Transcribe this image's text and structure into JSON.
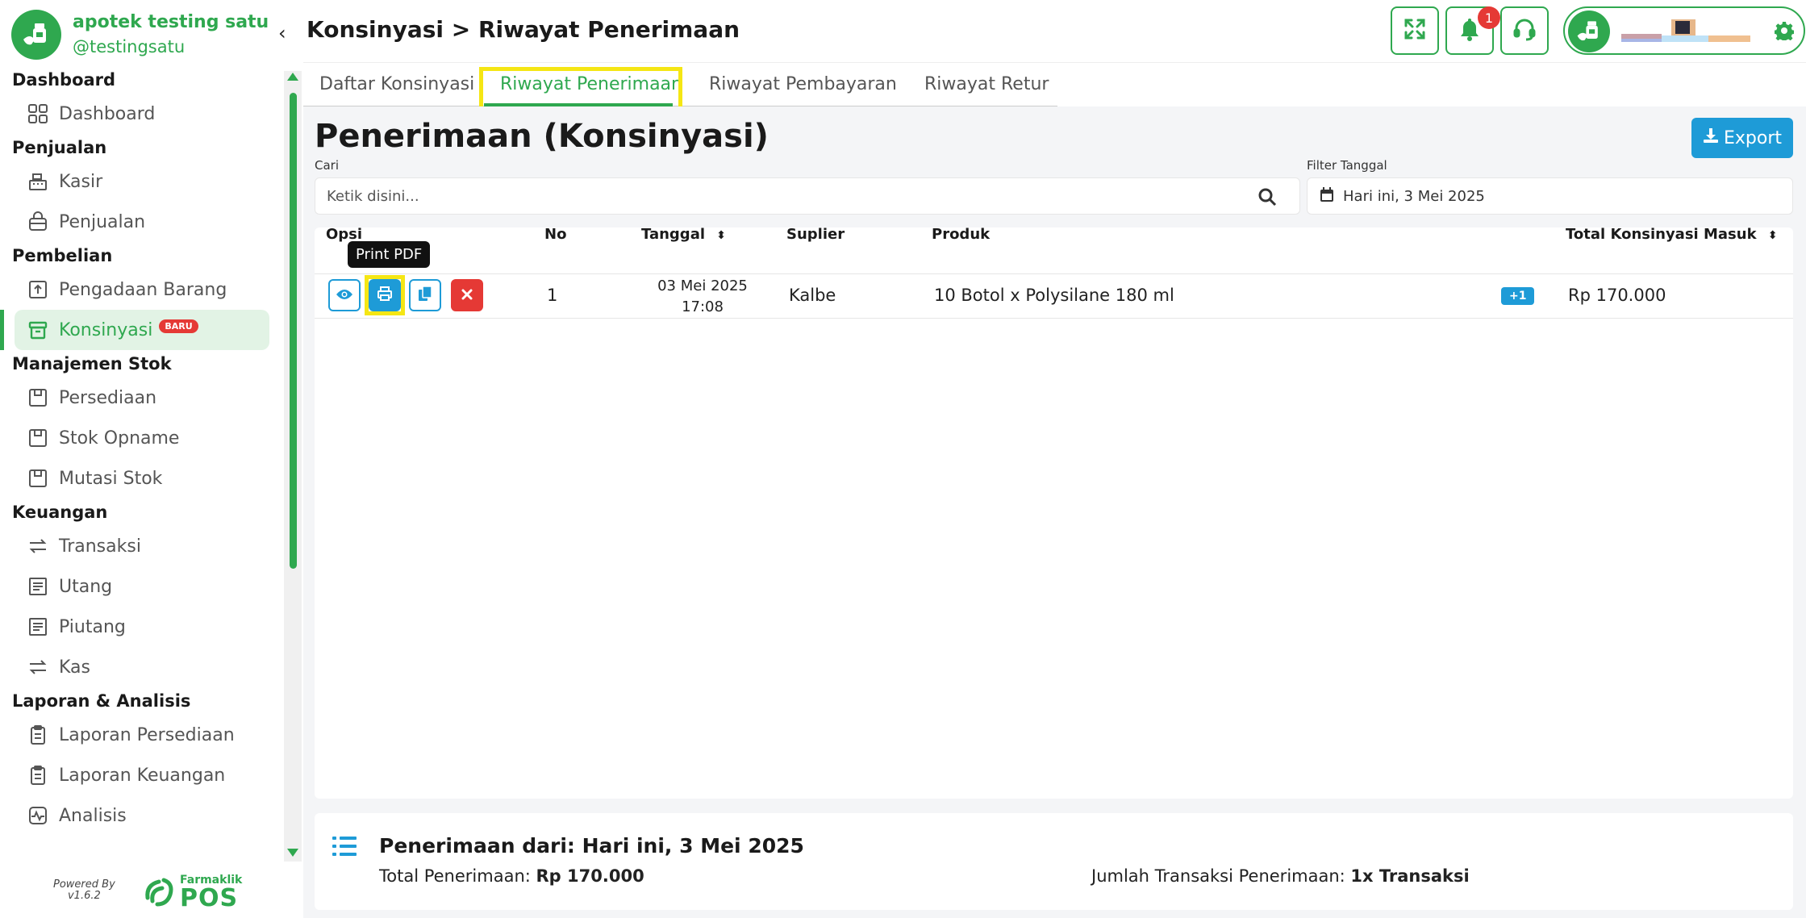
{
  "brand": {
    "name": "apotek testing satu",
    "username": "@testingsatu"
  },
  "sidebar": {
    "sections": [
      {
        "title": "Dashboard",
        "items": [
          {
            "label": "Dashboard",
            "icon": "grid-icon"
          }
        ]
      },
      {
        "title": "Penjualan",
        "items": [
          {
            "label": "Kasir",
            "icon": "cash-register-icon"
          },
          {
            "label": "Penjualan",
            "icon": "shopping-bag-icon"
          }
        ]
      },
      {
        "title": "Pembelian",
        "items": [
          {
            "label": "Pengadaan Barang",
            "icon": "upload-box-icon"
          },
          {
            "label": "Konsinyasi",
            "icon": "archive-box-icon",
            "badge": "BARU",
            "active": true
          }
        ]
      },
      {
        "title": "Manajemen Stok",
        "items": [
          {
            "label": "Persediaan",
            "icon": "inventory-icon"
          },
          {
            "label": "Stok Opname",
            "icon": "inventory-icon"
          },
          {
            "label": "Mutasi Stok",
            "icon": "inventory-icon"
          }
        ]
      },
      {
        "title": "Keuangan",
        "items": [
          {
            "label": "Transaksi",
            "icon": "exchange-icon"
          },
          {
            "label": "Utang",
            "icon": "ledger-icon"
          },
          {
            "label": "Piutang",
            "icon": "ledger-icon"
          },
          {
            "label": "Kas",
            "icon": "exchange-icon"
          }
        ]
      },
      {
        "title": "Laporan & Analisis",
        "items": [
          {
            "label": "Laporan Persediaan",
            "icon": "clipboard-icon"
          },
          {
            "label": "Laporan Keuangan",
            "icon": "clipboard-icon"
          },
          {
            "label": "Analisis",
            "icon": "activity-icon"
          }
        ]
      }
    ],
    "powered_by": "Powered By",
    "version": "v1.6.2",
    "footer_brand_small": "Farmaklik",
    "footer_brand_large": "POS"
  },
  "header": {
    "breadcrumb": "Konsinyasi > Riwayat Penerimaan",
    "notification_count": "1"
  },
  "tabs": [
    {
      "label": "Daftar Konsinyasi",
      "active": false
    },
    {
      "label": "Riwayat Penerimaan",
      "active": true
    },
    {
      "label": "Riwayat Pembayaran",
      "active": false
    },
    {
      "label": "Riwayat Retur",
      "active": false
    }
  ],
  "main": {
    "title": "Penerimaan (Konsinyasi)",
    "export_label": "Export",
    "search_label": "Cari",
    "search_placeholder": "Ketik disini...",
    "filter_label": "Filter Tanggal",
    "filter_value": "Hari ini, 3 Mei 2025"
  },
  "table": {
    "columns": {
      "opsi": "Opsi",
      "no": "No",
      "tanggal": "Tanggal",
      "suplier": "Suplier",
      "produk": "Produk",
      "total": "Total Konsinyasi Masuk"
    },
    "tooltip": "Print PDF",
    "rows": [
      {
        "no": "1",
        "tanggal_date": "03 Mei 2025",
        "tanggal_time": "17:08",
        "suplier": "Kalbe",
        "produk": "10 Botol x Polysilane 180 ml",
        "extra": "+1",
        "total": "Rp 170.000"
      }
    ]
  },
  "summary": {
    "title": "Penerimaan dari: Hari ini, 3 Mei 2025",
    "total_label": "Total Penerimaan: ",
    "total_value": "Rp 170.000",
    "count_label": "Jumlah Transaksi Penerimaan: ",
    "count_value": "1x Transaksi"
  },
  "colors": {
    "primary": "#2fa84f",
    "accent": "#1e9bd7",
    "danger": "#e53935",
    "highlight": "#f5e614"
  }
}
